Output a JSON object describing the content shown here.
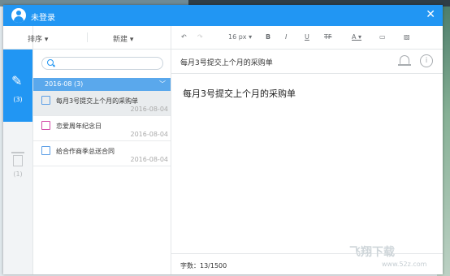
{
  "window": {
    "title": "未登录"
  },
  "toolbar": {
    "sort_label": "排序 ▾",
    "new_label": "新建 ▾"
  },
  "rail": {
    "notes_count": "(3)",
    "trash_count": "(1)"
  },
  "list": {
    "group_label": "2016-08 (3)",
    "items": [
      {
        "title": "每月3号提交上个月的采购单",
        "date": "2016-08-04",
        "icon": "note-icon"
      },
      {
        "title": "恋爱周年纪念日",
        "date": "2016-08-04",
        "icon": "calendar-icon"
      },
      {
        "title": "给合作商季总送合同",
        "date": "2016-08-04",
        "icon": "note-icon"
      }
    ]
  },
  "editor": {
    "font_size": "16 px ▾",
    "note_title": "每月3号提交上个月的采购单",
    "note_body": "每月3号提交上个月的采购单",
    "char_count": "字数：13/1500"
  },
  "watermark": {
    "brand": "飞翔下载",
    "url": "www.52z.com"
  },
  "colors": {
    "accent": "#2196f3",
    "group": "#5aa8ec",
    "selected": "#e9ecee"
  }
}
